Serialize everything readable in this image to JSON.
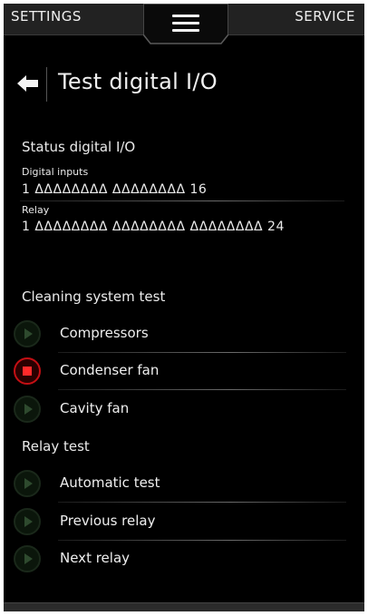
{
  "topbar": {
    "settings_label": "SETTINGS",
    "service_label": "SERVICE",
    "menu_icon": "hamburger-menu-icon"
  },
  "header": {
    "back_icon": "back-arrow-icon",
    "title": "Test digital I/O"
  },
  "status": {
    "heading": "Status digital I/O",
    "digital_inputs": {
      "label": "Digital inputs",
      "value": "1 ΔΔΔΔΔΔΔΔ ΔΔΔΔΔΔΔΔ 16"
    },
    "relay": {
      "label": "Relay",
      "value": "1 ΔΔΔΔΔΔΔΔ ΔΔΔΔΔΔΔΔ ΔΔΔΔΔΔΔΔ 24"
    }
  },
  "cleaning": {
    "heading": "Cleaning system test",
    "items": [
      {
        "label": "Compressors",
        "icon": "play-icon",
        "state": "idle"
      },
      {
        "label": "Condenser fan",
        "icon": "stop-icon",
        "state": "running"
      },
      {
        "label": "Cavity fan",
        "icon": "play-icon",
        "state": "idle"
      }
    ]
  },
  "relay_test": {
    "heading": "Relay test",
    "items": [
      {
        "label": "Automatic test",
        "icon": "play-icon"
      },
      {
        "label": "Previous relay",
        "icon": "play-icon"
      },
      {
        "label": "Next relay",
        "icon": "play-icon"
      }
    ]
  },
  "colors": {
    "background": "#000000",
    "bar": "#222222",
    "stop_accent": "#c40f14",
    "play_accent": "#2e4a2e"
  }
}
